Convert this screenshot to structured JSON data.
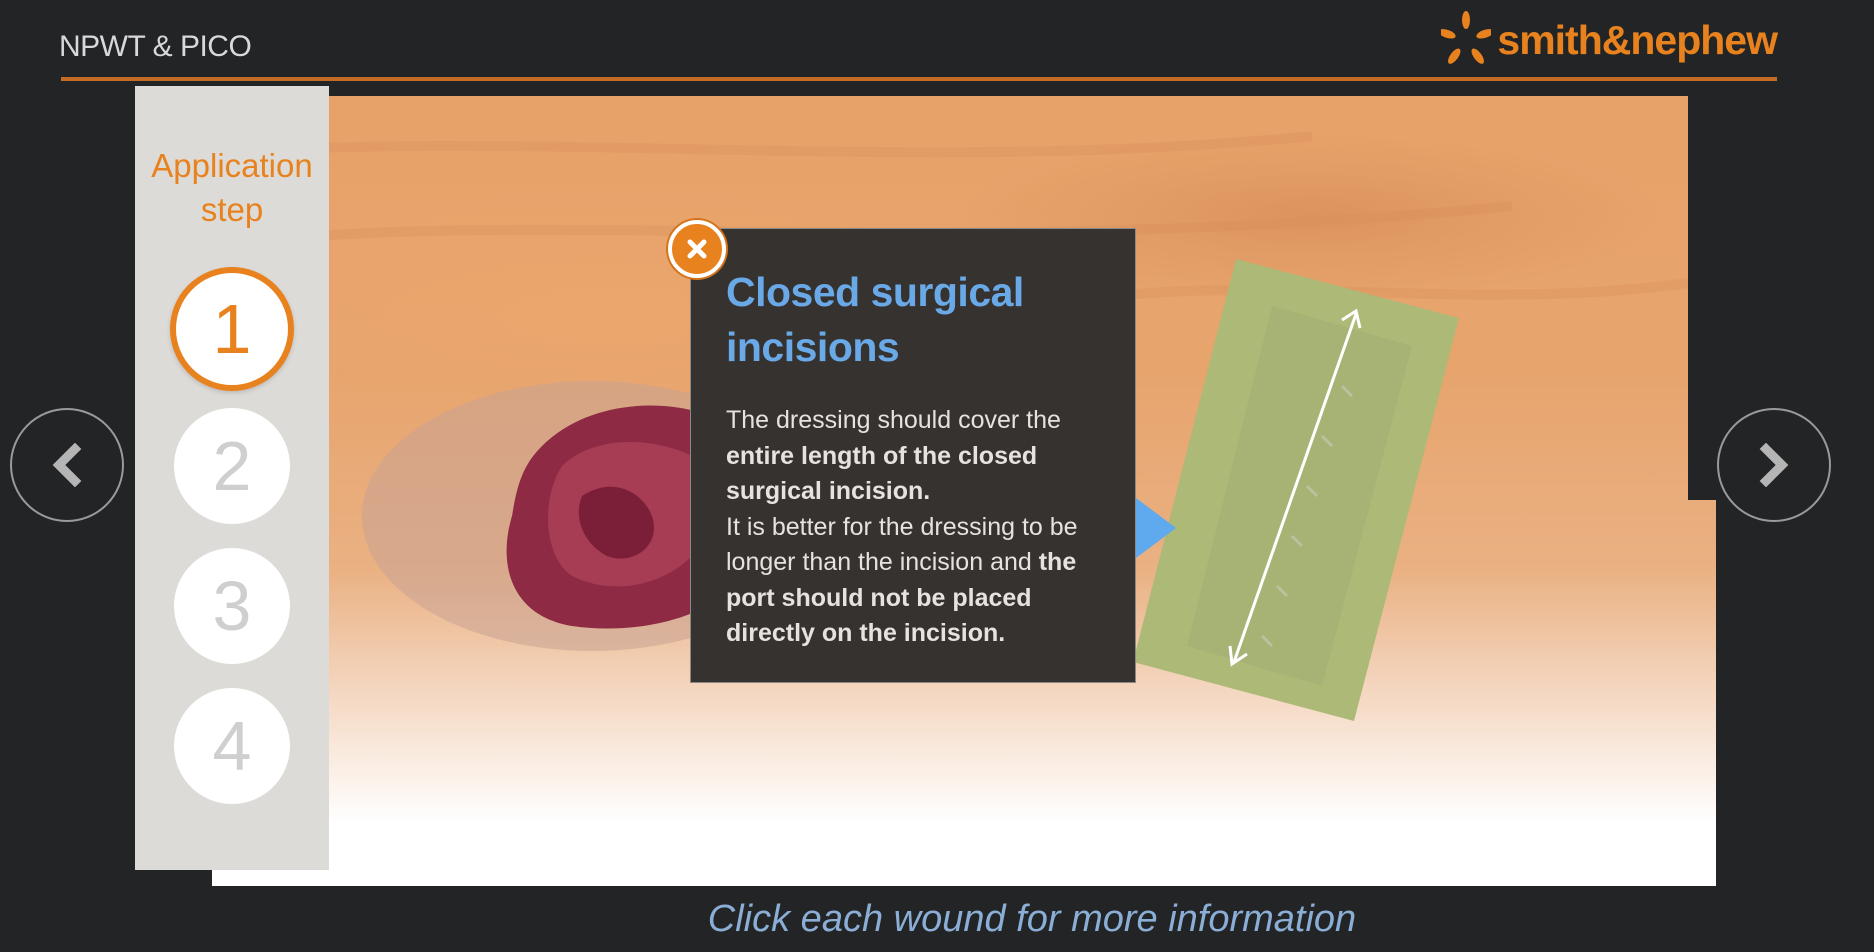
{
  "header": {
    "title": "NPWT & PICO",
    "brand": "smith&nephew",
    "brand_icon": "starburst-logo"
  },
  "sidebar": {
    "heading": "Application step",
    "steps": [
      {
        "label": "1",
        "active": true
      },
      {
        "label": "2",
        "active": false
      },
      {
        "label": "3",
        "active": false
      },
      {
        "label": "4",
        "active": false
      }
    ]
  },
  "navigation": {
    "prev_icon": "chevron-left-icon",
    "next_icon": "chevron-right-icon"
  },
  "popup": {
    "title": "Closed surgical incisions",
    "body": {
      "p1_plain": "The dressing should cover the ",
      "p1_bold": "entire length of the closed surgical incision.",
      "p2_plain": "It is better for the dressing to be longer than the incision and ",
      "p2_bold": "the port should not be placed directly on the incision."
    },
    "close_icon": "close-icon"
  },
  "caption": "Click each wound for more information",
  "colors": {
    "accent": "#e8821e",
    "popup_title": "#6aa9e8",
    "caption": "#8aaed6",
    "background": "#232426"
  }
}
